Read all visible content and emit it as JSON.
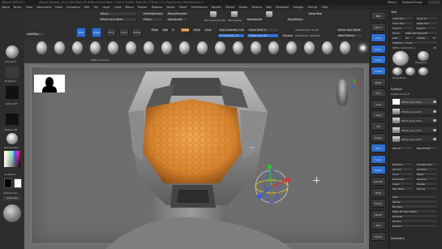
{
  "titlebar": {
    "title": "ZBrush 2022.0.1",
    "info": "ZBrush Sphere_101 ▸ Free Mem 25.4GB ▸ Active Mem 1,185 ▸ Scratch Disk 49 ▸ ZTime 1.2 ▸ PolyCount ▸ MeshCount ▸ 1",
    "menus": [
      "Alpha",
      "Brush",
      "Color",
      "Document",
      "Draw",
      "Dynamics",
      "Edit",
      "File",
      "Layer",
      "Light",
      "Macro",
      "Marker",
      "Material",
      "Movie",
      "Picker",
      "Preferences",
      "Render",
      "Stencil",
      "Stroke",
      "Texture",
      "Tool",
      "Transform",
      "Zplugin",
      "Zscript",
      "Help"
    ],
    "right": [
      "Menus",
      "DefaultZScript"
    ]
  },
  "toolbar": {
    "mirror": "Mirror",
    "mirror_and_weld": "Mirror And Weld",
    "polish_by_features": "PolishByFeatures",
    "relax_plane_grid": "RelaxPlaneGrid",
    "polish": "Polish",
    "adjust_last": "AdjustLast",
    "zremesher_guide": "ZRemesherGuide",
    "zremesher": "ZRemesher",
    "backface_mask": "BackfaceMask",
    "dynamesh": "DynaMesh",
    "new_mesh": "New Mesh",
    "mirror_symmetry": "Mirror",
    "move_label": "Move",
    "scale_label": "Scale",
    "rotate_label": "Rotate",
    "draw_label": "Draw",
    "edit_label": "Edit",
    "focal_shift": "Focal Shift 0",
    "draw_size": "Draw Size 64",
    "dynamic": "Dynamic",
    "active_points": "ActivePoints: 8,678",
    "total_points": "TotalPoints: 396,821",
    "mirror_weld": "Mirror and Weld",
    "weld_points": "Weld Points",
    "z_intensity": "Z Intensity 25",
    "rgb_intensity": "Rgb Intensity 100",
    "mrgb": "Mrgb",
    "rgb": "Rgb",
    "m": "M",
    "zadd": "Zadd",
    "zsub": "Zsub",
    "zcut": "Zcut"
  },
  "left_panel": {
    "lightbox": "LightBox",
    "brush_label": "Standard",
    "stroke_label": "DragRect",
    "alpha_label": "Alpha Off",
    "texture_label": "Texture Off",
    "material_label": "SkinShade4",
    "gradient": "Gradient",
    "switch_color": "SwitchColor",
    "alternate": "Alternate"
  },
  "shelf": {
    "tool_name": "PM3D_Sphere3"
  },
  "viewport": {
    "gizmo_hint": "XYZ"
  },
  "right_toolstrip": [
    "BPR",
    "SPix 3",
    "Scroll",
    "Zoom",
    "Actual",
    "AAHalf",
    "Persp",
    "Floor",
    "Local",
    "LSym",
    "Xyz",
    "Frame",
    "Move",
    "Scale",
    "Rotate",
    "Line Fill",
    "PolyF",
    "Transp",
    "Ghost",
    "Solo",
    "Xpose"
  ],
  "tool_panel": {
    "header": "Tool",
    "load_tool": "Load Tool",
    "save_as": "Save As",
    "copy_tool": "Copy Tool",
    "paste_tool": "Paste Tool",
    "import": "Import",
    "export": "Export",
    "clone": "Clone",
    "make_polymesh": "Make PolyMesh3D",
    "goz": "GoZ",
    "all": "All",
    "visible": "Visible",
    "r": "R",
    "lightbox_tools": "Lightbox > Tools",
    "current_tool": "PM3D_Sphere3D_1",
    "count": "48",
    "thumbs": [
      "PM3D_Sphere3D",
      "PolySphere",
      "SimpleBrush",
      "ZSphere",
      "PM3D_Sphere3D_1",
      "PM3D_Cube3D"
    ],
    "subtool_header": "Subtool",
    "visible_count": "Visible Count 6",
    "subtools": [
      "PM3D_Sphere3D1",
      "PM3D_Sphere3D2",
      "PM3D_Sphere3D3",
      "PM3D_Sphere3D4",
      "PM3D_Sphere3D5"
    ],
    "list_all": "List All",
    "new_folder": "New Folder",
    "rename": "Rename",
    "autoreorder": "AutoReorder",
    "all_low": "All Low",
    "all_high": "All High",
    "copy": "Copy",
    "paste": "Paste",
    "duplicate": "Duplicate",
    "append": "Append",
    "insert": "Insert",
    "delete": "Delete",
    "del_other": "Del Other",
    "del_all": "Del All",
    "split": "Split",
    "merge": "Merge",
    "boolean": "Boolean",
    "make_boolean_mesh": "Make Boolean Mesh",
    "remesh": "Remesh",
    "project": "Project",
    "extract": "Extract",
    "geometry": "Geometry"
  },
  "colors": {
    "accent": "#2f6fd0",
    "orange_mask": "#e39a3a",
    "viewport_bg": "#6e6e6e",
    "panel_bg": "#2d2d2d"
  }
}
